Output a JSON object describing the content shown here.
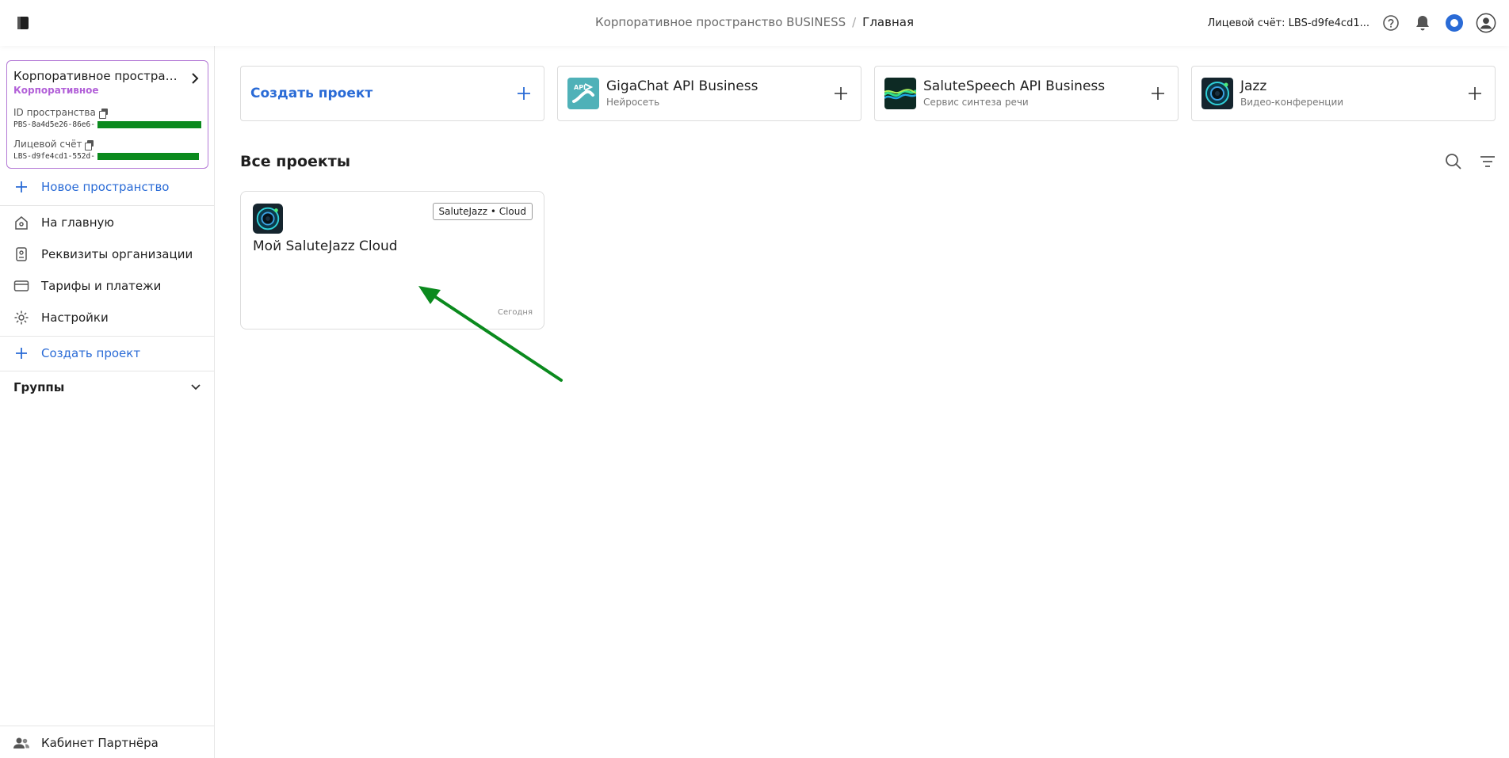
{
  "header": {
    "breadcrumb_space": "Корпоративное пространство BUSINESS",
    "breadcrumb_separator": "/",
    "breadcrumb_current": "Главная",
    "account_label": "Лицевой счёт: LBS-d9fe4cd1...",
    "icons": [
      "logo-icon",
      "help-icon",
      "bell-icon",
      "assistant-icon",
      "profile-icon"
    ]
  },
  "sidebar": {
    "space": {
      "name": "Корпоративное простран...",
      "type": "Корпоративное",
      "id_label": "ID пространства",
      "id_value": "PBS-8a4d5e26-86e6-",
      "account_label": "Лицевой счёт",
      "account_value": "LBS-d9fe4cd1-552d-"
    },
    "new_space": "Новое пространство",
    "items": [
      {
        "label": "На главную",
        "icon": "home-icon"
      },
      {
        "label": "Реквизиты организации",
        "icon": "id-card-icon"
      },
      {
        "label": "Тарифы и платежи",
        "icon": "card-icon"
      },
      {
        "label": "Настройки",
        "icon": "gear-icon"
      }
    ],
    "create_project": "Создать проект",
    "groups_label": "Группы",
    "partner_label": "Кабинет Партнёра"
  },
  "main": {
    "tiles": [
      {
        "title": "Создать проект",
        "subtitle": ""
      },
      {
        "title": "GigaChat API Business",
        "subtitle": "Нейросеть",
        "icon": "gigachat-api-icon"
      },
      {
        "title": "SaluteSpeech API Business",
        "subtitle": "Сервис синтеза речи",
        "icon": "salutespeech-icon"
      },
      {
        "title": "Jazz",
        "subtitle": "Видео-конференции",
        "icon": "jazz-icon"
      }
    ],
    "section_title": "Все проекты",
    "projects": [
      {
        "name": "Мой SaluteJazz Cloud",
        "badge": "SaluteJazz • Cloud",
        "date": "Сегодня",
        "icon": "jazz-icon"
      }
    ]
  },
  "colors": {
    "accent": "#2a6bd6",
    "space_border": "#b47ad6",
    "space_type": "#b260d8",
    "redaction": "#0b8a1e",
    "annotation_arrow": "#0b8a1e"
  }
}
